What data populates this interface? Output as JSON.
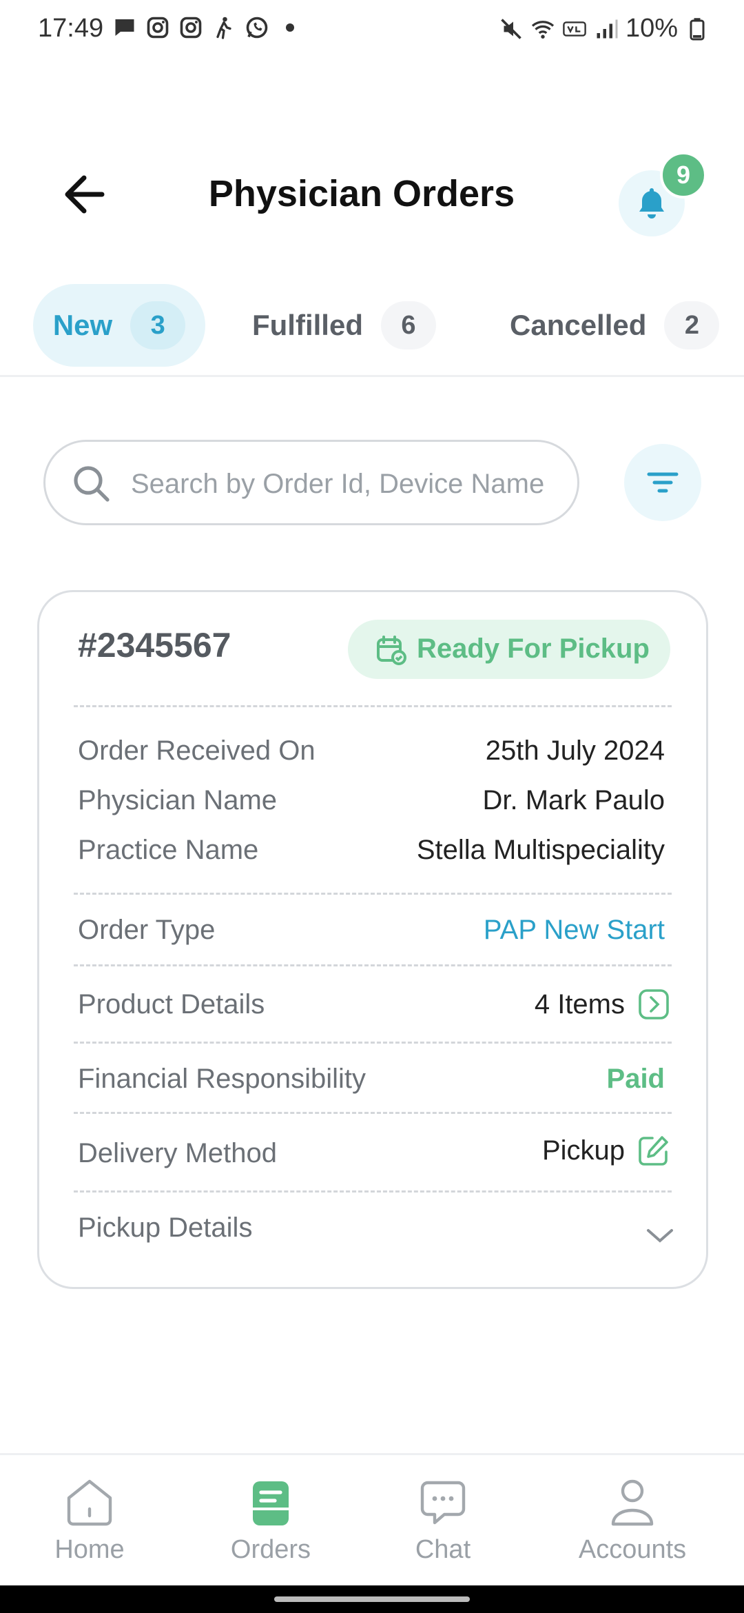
{
  "status_bar": {
    "time": "17:49",
    "left_icons": [
      "message-icon",
      "instagram-icon",
      "instagram-icon",
      "walking-icon",
      "whatsapp-icon",
      "dot-icon"
    ],
    "right_icons": [
      "mute-icon",
      "wifi-icon",
      "volte-icon",
      "signal-icon",
      "battery-icon"
    ],
    "battery": "10%"
  },
  "header": {
    "title": "Physician Orders",
    "notification_count": "9"
  },
  "tabs": [
    {
      "label": "New",
      "count": "3",
      "active": true
    },
    {
      "label": "Fulfilled",
      "count": "6",
      "active": false
    },
    {
      "label": "Cancelled",
      "count": "2",
      "active": false
    }
  ],
  "search": {
    "placeholder": "Search by Order Id, Device Name",
    "value": ""
  },
  "order": {
    "id": "#2345567",
    "status": "Ready For Pickup",
    "rows": {
      "received_label": "Order Received On",
      "received_value": "25th July 2024",
      "physician_label": "Physician Name",
      "physician_value": "Dr. Mark Paulo",
      "practice_label": "Practice Name",
      "practice_value": "Stella Multispeciality",
      "order_type_label": "Order Type",
      "order_type_value": "PAP New Start",
      "product_label": "Product Details",
      "product_value": "4 Items",
      "financial_label": "Financial Responsibility",
      "financial_value": "Paid",
      "delivery_label": "Delivery Method",
      "delivery_value": "Pickup",
      "pickup_label": "Pickup Details"
    }
  },
  "bottom_nav": [
    {
      "label": "Home",
      "icon": "home-icon"
    },
    {
      "label": "Orders",
      "icon": "orders-icon",
      "active": true
    },
    {
      "label": "Chat",
      "icon": "chat-icon"
    },
    {
      "label": "Accounts",
      "icon": "account-icon"
    }
  ],
  "colors": {
    "accent_blue": "#2aa0c9",
    "accent_green": "#5dbd85",
    "tab_active_bg": "#e6f5fa",
    "pill_bg": "#e4f6ec"
  }
}
